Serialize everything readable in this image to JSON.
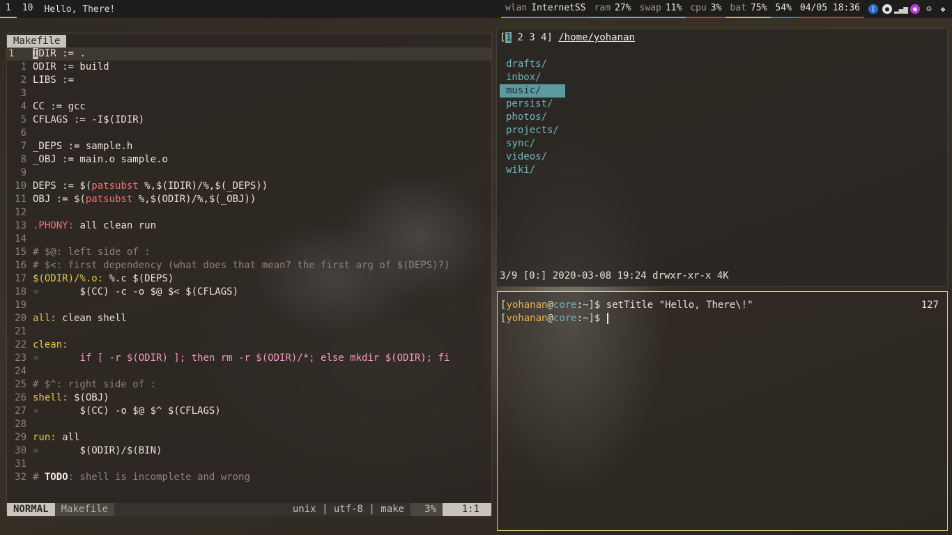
{
  "bar": {
    "workspaces": [
      "1",
      "10"
    ],
    "window_title": "Hello, There!",
    "wlan": {
      "label": "wlan",
      "value": "InternetSS"
    },
    "ram": {
      "label": "ram",
      "value": "27%"
    },
    "swap": {
      "label": "swap",
      "value": "11%"
    },
    "cpu": {
      "label": "cpu",
      "value": "3%"
    },
    "bat": {
      "label": "bat",
      "value": "75%"
    },
    "volume": "54%",
    "datetime": "04/05 18:36",
    "tray": [
      "bluetooth-icon",
      "steam-icon",
      "signal-icon",
      "firefox-icon",
      "discord-icon",
      "dropbox-icon"
    ]
  },
  "editor": {
    "tab": "Makefile",
    "lines": [
      {
        "n": "1",
        "text": "IDIR := ."
      },
      {
        "n": "1",
        "text": "ODIR := build"
      },
      {
        "n": "2",
        "text": "LIBS :="
      },
      {
        "n": "3",
        "text": ""
      },
      {
        "n": "4",
        "text": "CC := gcc"
      },
      {
        "n": "5",
        "text": "CFLAGS := -I$(IDIR)"
      },
      {
        "n": "6",
        "text": ""
      },
      {
        "n": "7",
        "text": "_DEPS := sample.h"
      },
      {
        "n": "8",
        "text": "_OBJ := main.o sample.o"
      },
      {
        "n": "9",
        "text": ""
      },
      {
        "n": "10",
        "text": "DEPS := $(patsubst %,$(IDIR)/%,$(_DEPS))"
      },
      {
        "n": "11",
        "text": "OBJ := $(patsubst %,$(ODIR)/%,$(_OBJ))"
      },
      {
        "n": "12",
        "text": ""
      },
      {
        "n": "13",
        "text": ".PHONY: all clean run"
      },
      {
        "n": "14",
        "text": ""
      },
      {
        "n": "15",
        "text": "# $@: left side of :"
      },
      {
        "n": "16",
        "text": "# $<: first dependency (what does that mean? the first arg of $(DEPS)?)"
      },
      {
        "n": "17",
        "text": "$(ODIR)/%.o: %.c $(DEPS)"
      },
      {
        "n": "18",
        "text": "»       $(CC) -c -o $@ $< $(CFLAGS)"
      },
      {
        "n": "19",
        "text": ""
      },
      {
        "n": "20",
        "text": "all: clean shell"
      },
      {
        "n": "21",
        "text": ""
      },
      {
        "n": "22",
        "text": "clean:"
      },
      {
        "n": "23",
        "text": "»       if [ -r $(ODIR) ]; then rm -r $(ODIR)/*; else mkdir $(ODIR); fi"
      },
      {
        "n": "24",
        "text": ""
      },
      {
        "n": "25",
        "text": "# $^: right side of :"
      },
      {
        "n": "26",
        "text": "shell: $(OBJ)"
      },
      {
        "n": "27",
        "text": "»       $(CC) -o $@ $^ $(CFLAGS)"
      },
      {
        "n": "28",
        "text": ""
      },
      {
        "n": "29",
        "text": "run: all"
      },
      {
        "n": "30",
        "text": "»       $(ODIR)/$(BIN)"
      },
      {
        "n": "31",
        "text": ""
      },
      {
        "n": "32",
        "text": "# TODO: shell is incomplete and wrong"
      }
    ],
    "status": {
      "mode": "NORMAL",
      "file": "Makefile",
      "info": "unix | utf-8 | make",
      "percent": "3%",
      "position": "1:1"
    }
  },
  "filemanager": {
    "tabs": [
      "1",
      "2",
      "3",
      "4"
    ],
    "path": "/home/yohanan",
    "items": [
      "drafts/",
      "inbox/",
      "music/",
      "persist/",
      "photos/",
      "projects/",
      "sync/",
      "videos/",
      "wiki/"
    ],
    "selected": "music/",
    "footer": "3/9 [0:] 2020-03-08 19:24 drwxr-xr-x 4K"
  },
  "terminal": {
    "user": "yohanan",
    "host": "core",
    "dir": "~",
    "line1_cmd": "setTitle \"Hello, There\\!\"",
    "count": "127",
    "line2_cmd": ""
  }
}
